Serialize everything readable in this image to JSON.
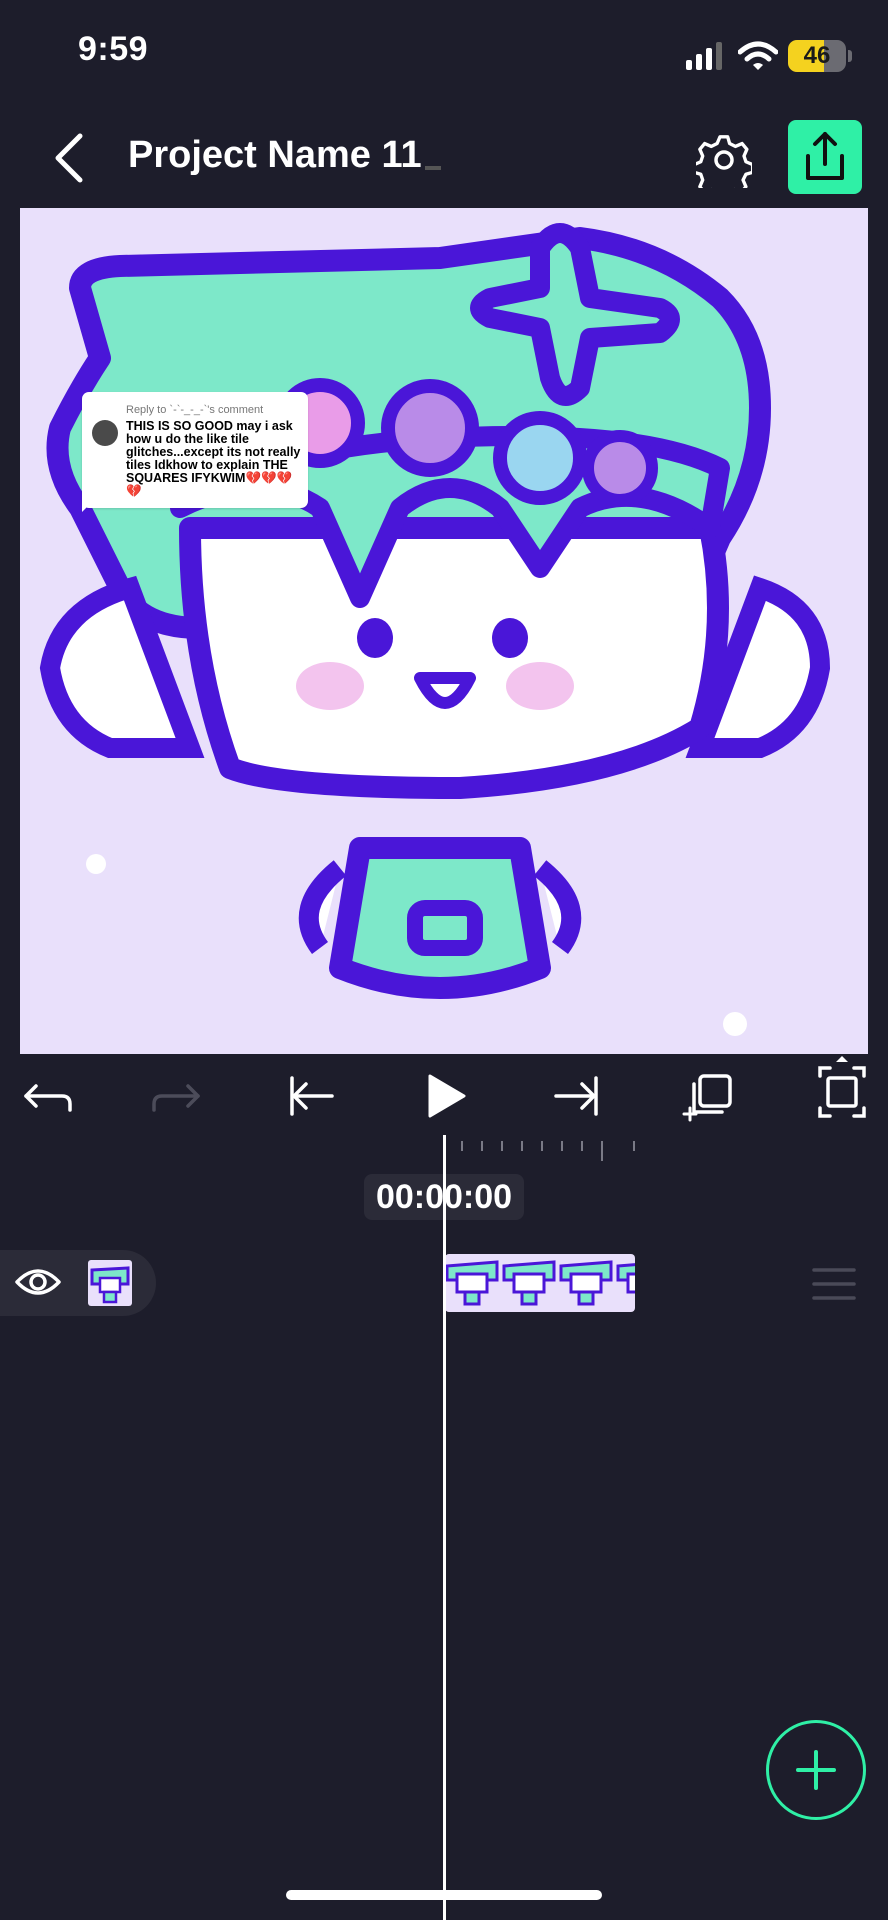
{
  "status_bar": {
    "time": "9:59",
    "battery": "46"
  },
  "header": {
    "title": "Project Name 11"
  },
  "comment_bubble": {
    "reply_to": "Reply to `-`-_-_-`'s comment",
    "text": "THIS IS SO GOOD may i ask how u do the like tile glitches...except its not really tiles Idkhow to explain THE SQUARES IFYKWIM💔💔💔💔"
  },
  "timeline": {
    "timecode": "00:00:00"
  },
  "colors": {
    "accent": "#2ff0a6",
    "background": "#1d1d2b",
    "canvas": "#e9e0fb",
    "outline": "#4a16d8",
    "mint": "#7de8c9"
  },
  "icons": [
    "back-icon",
    "gear-icon",
    "export-icon",
    "undo-icon",
    "redo-icon",
    "skip-start-icon",
    "play-icon",
    "skip-end-icon",
    "duplicate-icon",
    "fit-screen-icon",
    "eye-icon",
    "drag-handle-icon",
    "plus-icon"
  ]
}
